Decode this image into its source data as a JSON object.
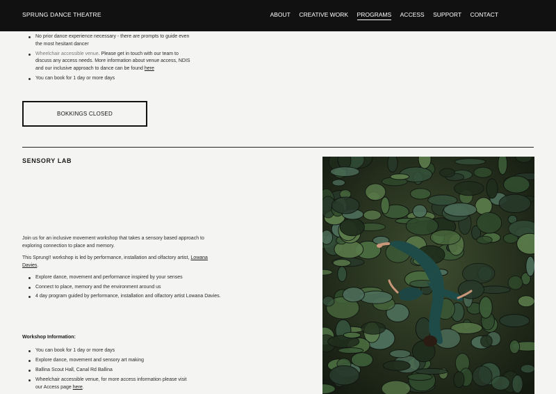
{
  "header": {
    "brand": "SPRUNG DANCE THEATRE",
    "nav": [
      "ABOUT",
      "CREATIVE WORK",
      "PROGRAMS",
      "ACCESS",
      "SUPPORT",
      "CONTACT"
    ],
    "active_nav": "PROGRAMS"
  },
  "top_list": {
    "item1": "No prior dance experience necessary - there are prompts to guide even the most hesitant dancer",
    "item2_link": "Wheelchair accessible venue",
    "item2_text": ". Please get in touch with our team to discuss any access needs. More information about venue access, NDIS and our inclusive approach to dance can be found ",
    "item2_here": "here",
    "item3": "You can book for 1 day or more days"
  },
  "booking_button": "BOKKINGS CLOSED",
  "section": {
    "title": "SENSORY LAB",
    "intro": "Join us for an inclusive movement workshop that takes a sensory based approach to exploring connection to place and memory.",
    "led_by_text": "This Sprung!! workshop is led by performance, installation and olfactory artist, ",
    "led_by_link": "Lowana Davies",
    "led_by_end": ".",
    "highlights": [
      "Explore dance, movement and performance inspired by your senses",
      "Connect to place, memory and the environment around us",
      "4 day program guided by performance, installation and olfactory artist Lowana Davies."
    ],
    "info_heading": "Workshop Information:",
    "info_items": [
      "You can book for 1 day or more days",
      "Explore dance, movement and sensory art making",
      "Ballina Scout Hall, Canal Rd Ballina"
    ],
    "access_text": "Wheelchair accessible venue, for more access information please visit our Access page ",
    "access_link": "here",
    "access_end": "."
  },
  "colors": {
    "header_bg": "#111111",
    "page_bg": "#f4f4f2",
    "text": "#1a1a1a"
  }
}
